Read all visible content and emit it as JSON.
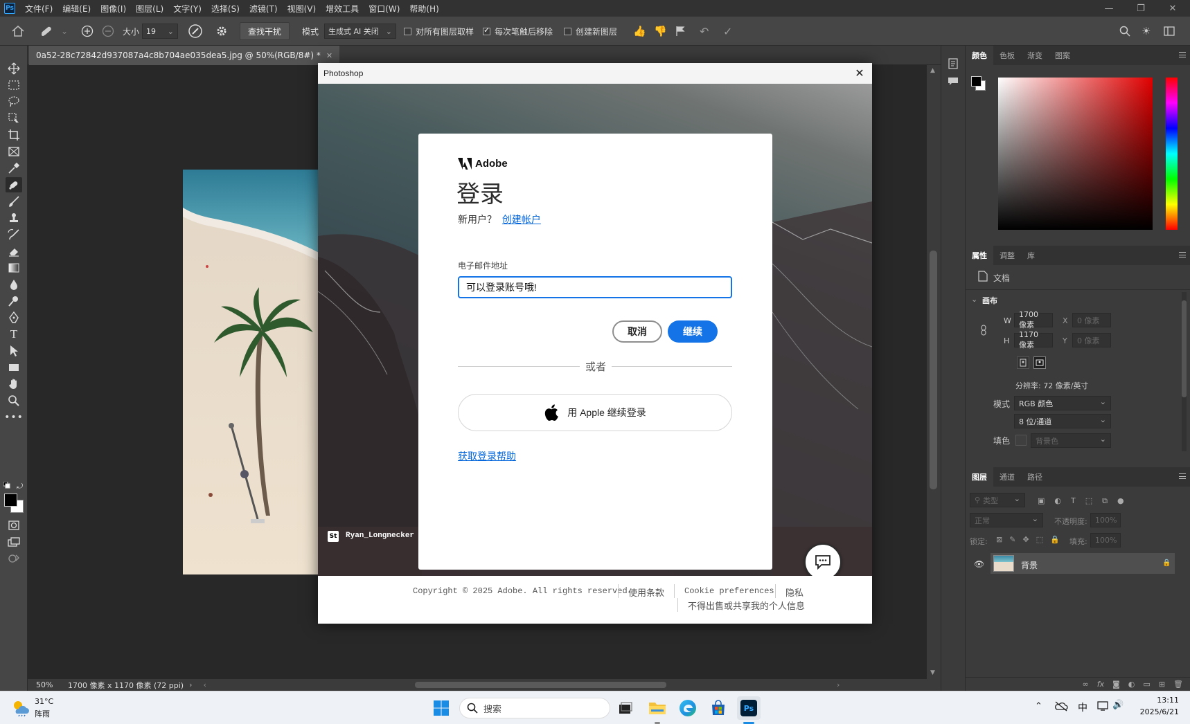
{
  "menubar": {
    "logo": "Ps",
    "items": [
      "文件(F)",
      "编辑(E)",
      "图像(I)",
      "图层(L)",
      "文字(Y)",
      "选择(S)",
      "滤镜(T)",
      "视图(V)",
      "增效工具",
      "窗口(W)",
      "帮助(H)"
    ]
  },
  "options": {
    "size_label": "大小",
    "size_value": "19",
    "find_distractions": "查找干扰",
    "mode_label": "模式",
    "mode_value": "生成式 AI 关闭",
    "sample_all_layers": "对所有图层取样",
    "remove_after_stroke": "每次笔触后移除",
    "create_new_layer": "创建新图层",
    "sample_all_checked": false,
    "remove_after_checked": true,
    "new_layer_checked": false
  },
  "document": {
    "tab_title": "0a52-28c72842d937087a4c8b704ae035dea5.jpg @ 50%(RGB/8#) *",
    "zoom": "50%",
    "doc_info": "1700 像素 x 1170 像素 (72 ppi)"
  },
  "dialog": {
    "window_title": "Photoshop",
    "brand": "Adobe",
    "heading": "登录",
    "new_user": "新用户？",
    "create_account": "创建帐户",
    "email_label": "电子邮件地址",
    "email_value": "可以登录账号哦!",
    "cancel": "取消",
    "continue": "继续",
    "or": "或者",
    "apple_signin": "用 Apple 继续登录",
    "help_link": "获取登录帮助",
    "photo_credit_badge": "St",
    "photo_credit": "Ryan_Longnecker",
    "copyright": "Copyright © 2025 Adobe. All rights reserved.",
    "terms": "使用条款",
    "cookie": "Cookie preferences",
    "privacy": "隐私",
    "do_not_sell": "不得出售或共享我的个人信息"
  },
  "color_panel": {
    "tabs": [
      "颜色",
      "色板",
      "渐变",
      "图案"
    ]
  },
  "properties_panel": {
    "tabs": [
      "属性",
      "调整",
      "库"
    ],
    "doc_label": "文档",
    "canvas_section": "画布",
    "w_label": "W",
    "w_value": "1700 像素",
    "h_label": "H",
    "h_value": "1170 像素",
    "x_label": "X",
    "x_value": "0 像素",
    "y_label": "Y",
    "y_value": "0 像素",
    "resolution": "分辨率: 72 像素/英寸",
    "mode_label": "模式",
    "mode_value": "RGB 颜色",
    "depth_value": "8 位/通道",
    "fill_label": "填色",
    "fill_value": "背景色"
  },
  "layers_panel": {
    "tabs": [
      "图层",
      "通道",
      "路径"
    ],
    "filter_placeholder": "类型",
    "blend_mode": "正常",
    "opacity_label": "不透明度:",
    "opacity_value": "100%",
    "lock_label": "锁定:",
    "fill_label": "填充:",
    "fill_value": "100%",
    "layer_name": "背景"
  },
  "taskbar": {
    "weather_temp": "31°C",
    "weather_desc": "阵雨",
    "search_placeholder": "搜索",
    "ime": "中",
    "time": "13:11",
    "date": "2025/6/21"
  },
  "colors": {
    "adobe_blue": "#1473e6",
    "ps_blue": "#31a8ff",
    "foreground": "#000000",
    "background": "#ffffff"
  }
}
